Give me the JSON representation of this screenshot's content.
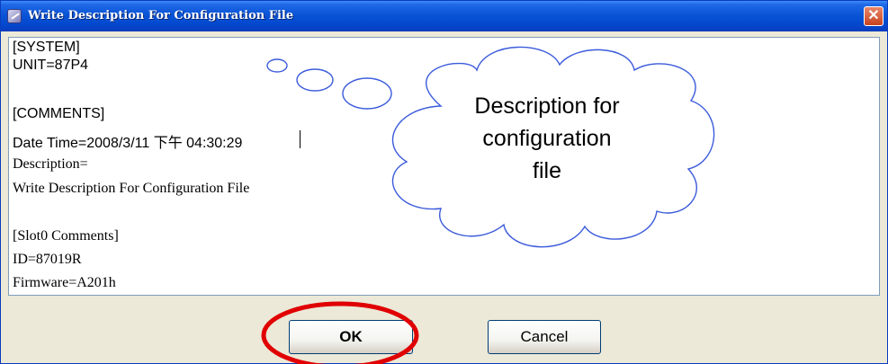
{
  "window": {
    "title": "Write Description For Configuration  File",
    "close_glyph": "✕"
  },
  "editor": {
    "lines": [
      "[SYSTEM]",
      "UNIT=87P4",
      "[COMMENTS]",
      "Date Time=2008/3/11 下午 04:30:29",
      "Description=",
      "Write Description For Configuration  File",
      "[Slot0 Comments]",
      "ID=87019R",
      "Firmware=A201h"
    ]
  },
  "callout": {
    "lines": [
      "Description for",
      "configuration",
      "file"
    ],
    "stroke_color": "#3b5bdb"
  },
  "buttons": {
    "ok_label": "OK",
    "cancel_label": "Cancel",
    "highlight_color": "#e00000"
  }
}
